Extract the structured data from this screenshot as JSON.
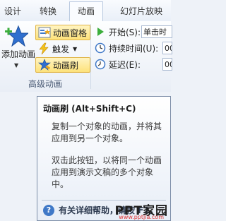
{
  "tabs": [
    {
      "label": "设计"
    },
    {
      "label": "转换"
    },
    {
      "label": "动画",
      "active": true
    },
    {
      "label": "幻灯片放映"
    }
  ],
  "ribbon": {
    "advanced_group": {
      "label": "高级动画",
      "add_animation": "添加动画",
      "animation_pane": "动画窗格",
      "trigger": "触发",
      "animation_painter": "动画刷"
    },
    "timing": {
      "start_label": "开始(S):",
      "start_value": "单击时",
      "duration_label": "持续时间(U):",
      "duration_value": "00",
      "delay_label": "延迟(E):",
      "delay_value": "00"
    }
  },
  "tooltip": {
    "title": "动画刷 (Alt+Shift+C)",
    "para1": "复制一个对象的动画，并将其应用到另一个对象。",
    "para2": "双击此按钮，以将同一个动画应用到演示文稿的多个对象中。",
    "help": "有关详细帮助，请按 F1。"
  },
  "watermark": {
    "text": "PPT家园",
    "url": "www.pptjia.com"
  },
  "colors": {
    "accent_star": "#2f6fcf",
    "highlight": "#fde27a",
    "watermark_url": "#dd3333"
  }
}
